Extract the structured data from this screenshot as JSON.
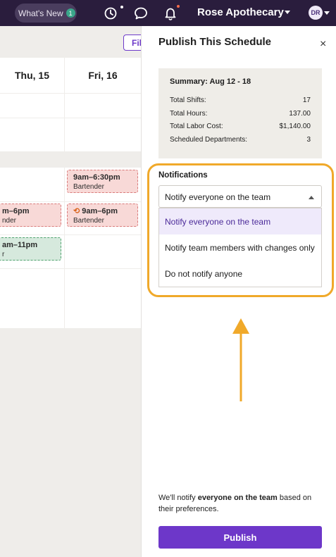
{
  "topbar": {
    "whats_new_label": "What's New",
    "whats_new_badge": "1",
    "brand_name": "Rose Apothecary",
    "avatar_initials": "DR",
    "icons": [
      "timer-icon",
      "chat-icon",
      "bell-icon"
    ],
    "accent": "#2a1d3d"
  },
  "schedule": {
    "filter_label": "Fil",
    "days": [
      {
        "label": "Thu, 15"
      },
      {
        "label": "Fri, 16"
      }
    ],
    "shifts": [
      {
        "time": "9am–6:30pm",
        "role": "Bartender"
      },
      {
        "time": "m–6pm",
        "role": "nder"
      },
      {
        "time": "9am–6pm",
        "role": "Bartender"
      },
      {
        "time": "am–11pm",
        "role": "r"
      }
    ]
  },
  "panel": {
    "title": "Publish This Schedule",
    "close_label": "×",
    "summary": {
      "title": "Summary: Aug 12 - 18",
      "rows": [
        {
          "label": "Total Shifts:",
          "value": "17"
        },
        {
          "label": "Total Hours:",
          "value": "137.00"
        },
        {
          "label": "Total Labor Cost:",
          "value": "$1,140.00"
        },
        {
          "label": "Scheduled Departments:",
          "value": "3"
        }
      ]
    },
    "notifications": {
      "label": "Notifications",
      "selected": "Notify everyone on the team",
      "options": [
        "Notify everyone on the team",
        "Notify team members with changes only",
        "Do not notify anyone"
      ]
    },
    "note": {
      "prefix": "We'll notify ",
      "bold": "everyone on the team",
      "suffix": " based on their preferences."
    },
    "publish_label": "Publish",
    "highlight_color": "#f0a92a",
    "button_color": "#6d37c9"
  }
}
